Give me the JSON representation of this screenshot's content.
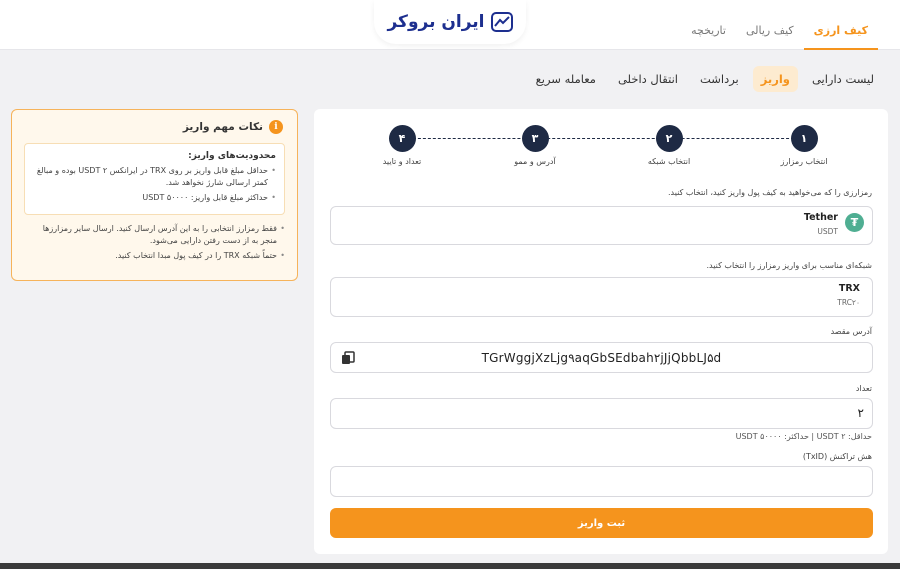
{
  "brand": {
    "logo_text": "ایران بروکر"
  },
  "top_tabs": [
    {
      "label": "کیف ارزی",
      "active": true
    },
    {
      "label": "کیف ریالی",
      "active": false
    },
    {
      "label": "تاریخچه",
      "active": false
    }
  ],
  "sub_tabs": [
    {
      "label": "لیست دارایی",
      "active": false
    },
    {
      "label": "واریز",
      "active": true
    },
    {
      "label": "برداشت",
      "active": false
    },
    {
      "label": "انتقال داخلی",
      "active": false
    },
    {
      "label": "معامله سریع",
      "active": false
    }
  ],
  "notes": {
    "title": "نکات مهم واریز",
    "limits_title": "محدودیت‌های واریز:",
    "limits": [
      "حداقل مبلغ قابل واریز بر روی TRX در ایرانکس ۲ USDT بوده و مبالغ کمتر ارسالی شارژ نخواهد شد.",
      "حداکثر مبلغ قابل واریز: ۵۰۰۰۰ USDT"
    ],
    "items": [
      "فقط رمزارز انتخابی را به این آدرس ارسال کنید. ارسال سایر رمزارزها منجر به از دست رفتن دارایی می‌شود.",
      "حتماً شبکه TRX را در کیف پول مبدا انتخاب کنید."
    ]
  },
  "steps": [
    {
      "num": "۱",
      "label": "انتخاب رمزارز"
    },
    {
      "num": "۲",
      "label": "انتخاب شبکه"
    },
    {
      "num": "۳",
      "label": "آدرس و ممو"
    },
    {
      "num": "۴",
      "label": "تعداد و تایید"
    }
  ],
  "form": {
    "currency_label": "رمزارزی را که می‌خواهید به کیف پول واریز کنید، انتخاب کنید.",
    "currency_name": "Tether",
    "currency_symbol": "USDT",
    "currency_icon": "tether-icon",
    "network_label": "شبکه‌ای مناسب برای واریز رمزارز را انتخاب کنید.",
    "network_name": "TRX",
    "network_sub": "TRC۲۰",
    "address_label": "آدرس مقصد",
    "address_value": "TGrWggjXzLjg۹aqGbSEdbah۲jJjQbbLJ۵d",
    "amount_label": "تعداد",
    "amount_value": "۲",
    "amount_hint": "حداقل: ۲ USDT | حداکثر: ۵۰۰۰۰ USDT",
    "txid_label": "هش تراکنش (TxID)",
    "txid_value": "",
    "submit_label": "ثبت واریز"
  },
  "colors": {
    "accent": "#f5941d",
    "step": "#1e2a44",
    "tether": "#4fae92"
  }
}
